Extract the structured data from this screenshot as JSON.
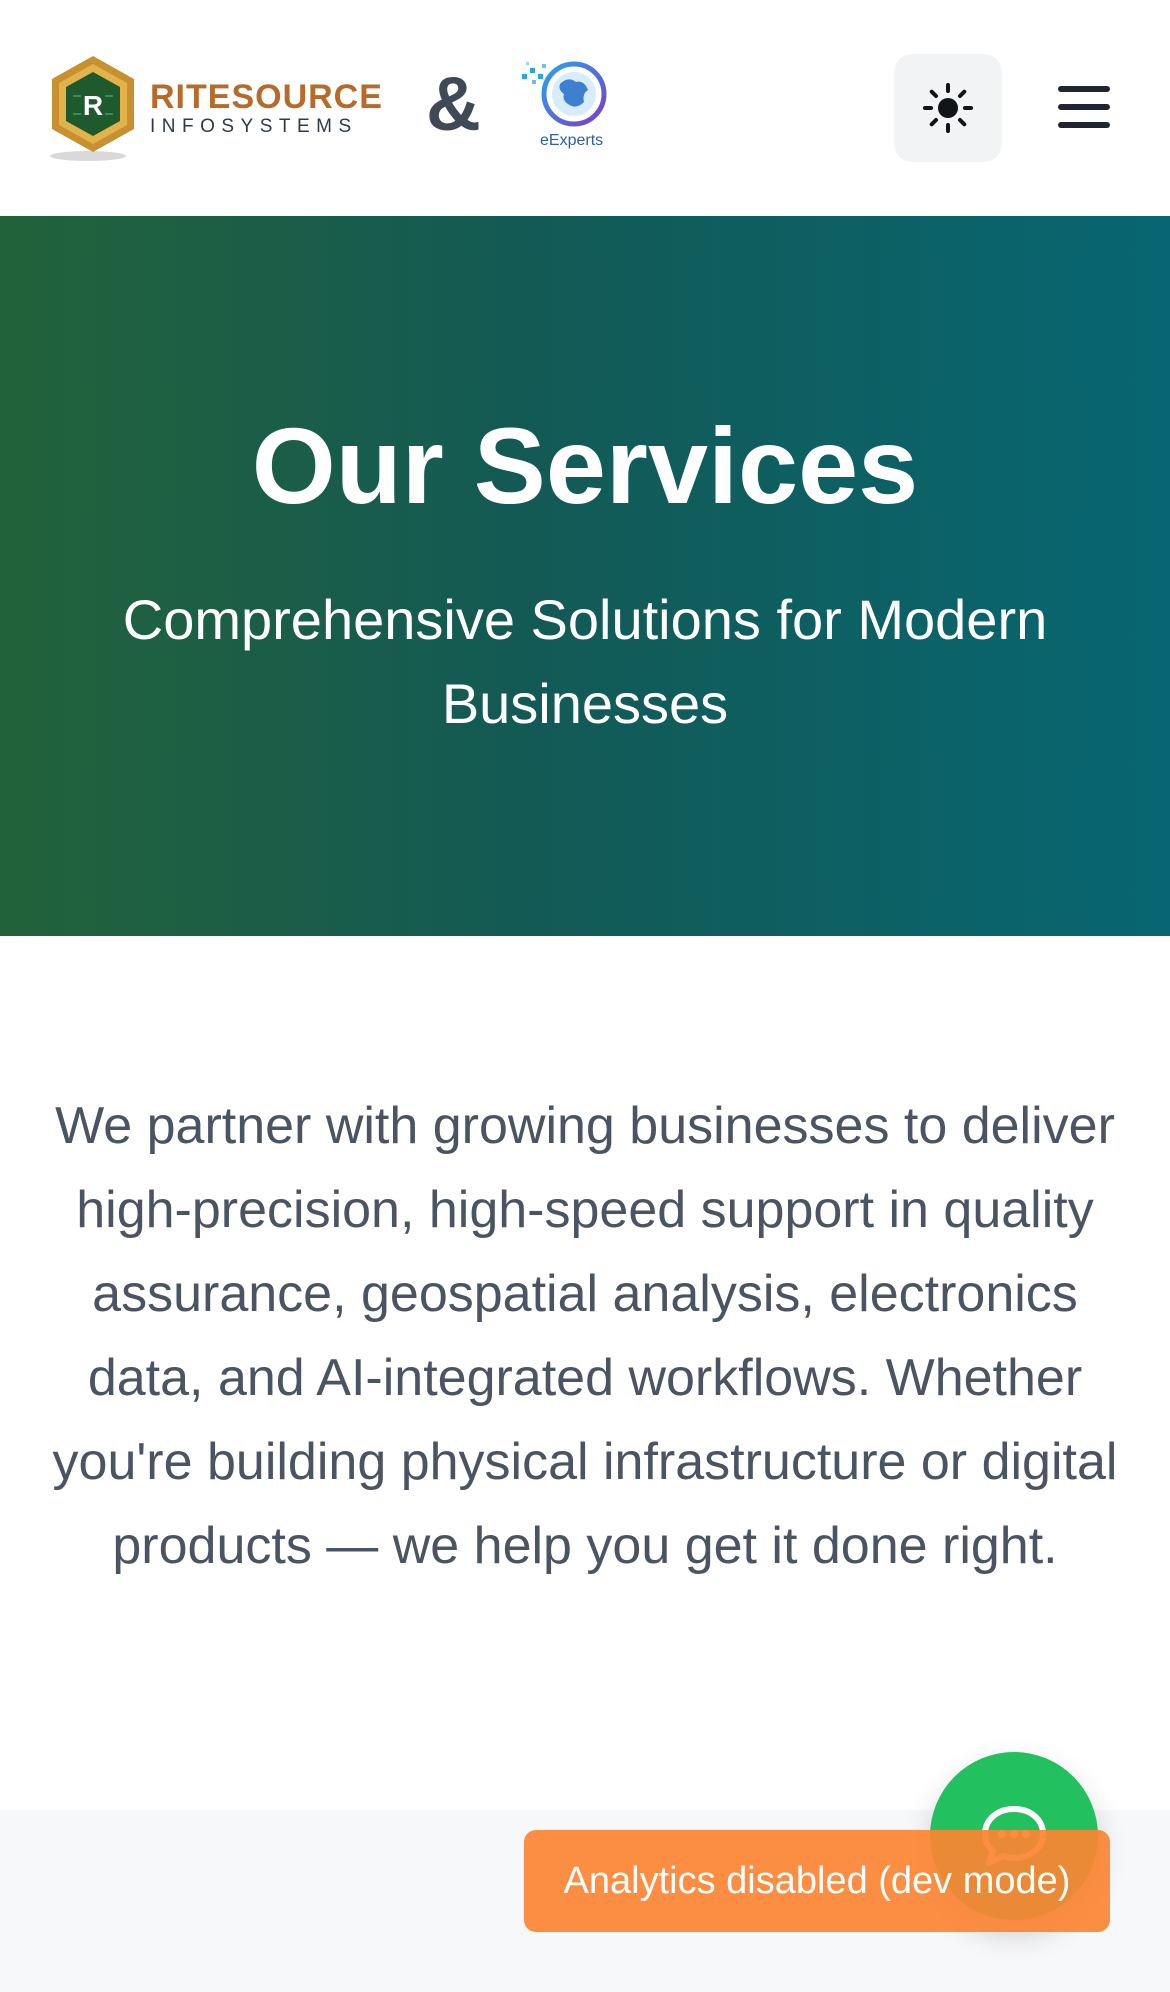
{
  "header": {
    "brand_main": "RITESOURCE",
    "brand_sub": "INFOSYSTEMS",
    "brand_mark_letter": "R",
    "ampersand": "&",
    "partner_name": "eExperts",
    "theme_toggle_icon": "sun-icon",
    "menu_icon": "hamburger-menu-icon"
  },
  "hero": {
    "title": "Our Services",
    "subtitle": "Comprehensive Solutions for Modern Businesses"
  },
  "intro": {
    "text": "We partner with growing businesses to deliver high-precision, high-speed support in quality assurance, geospatial analysis, electronics data, and AI-integrated workflows. Whether you're building physical infrastructure or digital products — we help you get it done right."
  },
  "chat": {
    "icon": "chat-bubble-icon"
  },
  "toast": {
    "text": "Analytics disabled (dev mode)"
  },
  "colors": {
    "hero_gradient_start": "#22623a",
    "hero_gradient_end": "#076672",
    "brand_orange": "#b86a2a",
    "chat_green": "#22c05e",
    "toast_orange": "#fb8534",
    "body_text": "#4a5463"
  }
}
